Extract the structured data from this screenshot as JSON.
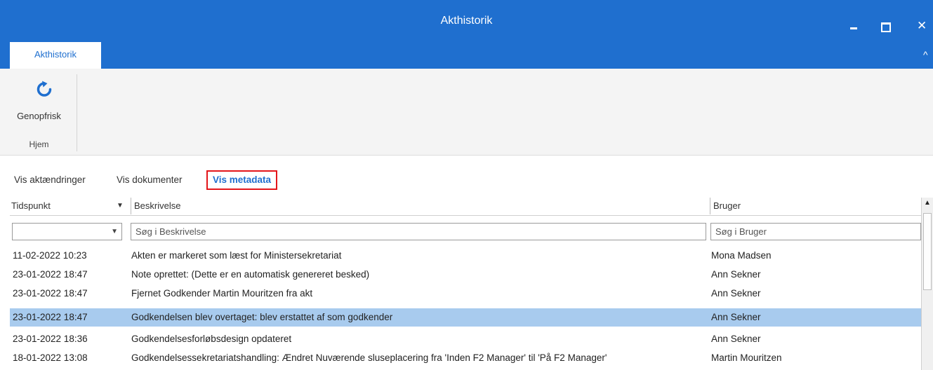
{
  "window": {
    "title": "Akthistorik",
    "minimize_icon": "minimize-icon",
    "maximize_icon": "maximize-icon",
    "close_label": "✕"
  },
  "tabs": [
    {
      "label": "Akthistorik",
      "active": true
    }
  ],
  "ribbon": {
    "refresh_label": "Genopfrisk",
    "refresh_icon": "refresh-icon",
    "group_label": "Hjem"
  },
  "view_links": [
    {
      "label": "Vis aktændringer"
    },
    {
      "label": "Vis dokumenter"
    },
    {
      "label": "Vis metadata",
      "active": true
    }
  ],
  "grid": {
    "columns": [
      "Tidspunkt",
      "Beskrivelse",
      "Bruger"
    ],
    "filters": {
      "tidspunkt_value": "",
      "beskrivelse_placeholder": "Søg i Beskrivelse",
      "bruger_placeholder": "Søg i Bruger"
    },
    "rows": [
      {
        "time": "11-02-2022 10:23",
        "description": "Akten er markeret som læst for Ministersekretariat",
        "user": "Mona Madsen"
      },
      {
        "time": "23-01-2022 18:47",
        "description": "Note oprettet: (Dette er en automatisk genereret besked)",
        "user": "Ann Sekner"
      },
      {
        "time": "23-01-2022 18:47",
        "description": "Fjernet Godkender Martin Mouritzen fra akt",
        "user": "Ann Sekner"
      },
      {
        "time": "23-01-2022 18:47",
        "description": "Godkendelsen blev overtaget:  blev erstattet af  som godkender",
        "user": "Ann Sekner",
        "selected": true
      },
      {
        "time": "23-01-2022 18:36",
        "description": "Godkendelsesforløbsdesign opdateret",
        "user": "Ann Sekner"
      },
      {
        "time": "18-01-2022 13:08",
        "description": "Godkendelsessekretariatshandling: Ændret Nuværende sluseplacering fra 'Inden F2 Manager' til 'På F2 Manager'",
        "user": "Martin Mouritzen"
      }
    ]
  },
  "colors": {
    "accent": "#1f6fcf",
    "selection": "#a8cbee",
    "highlight_border": "#e3151a"
  }
}
